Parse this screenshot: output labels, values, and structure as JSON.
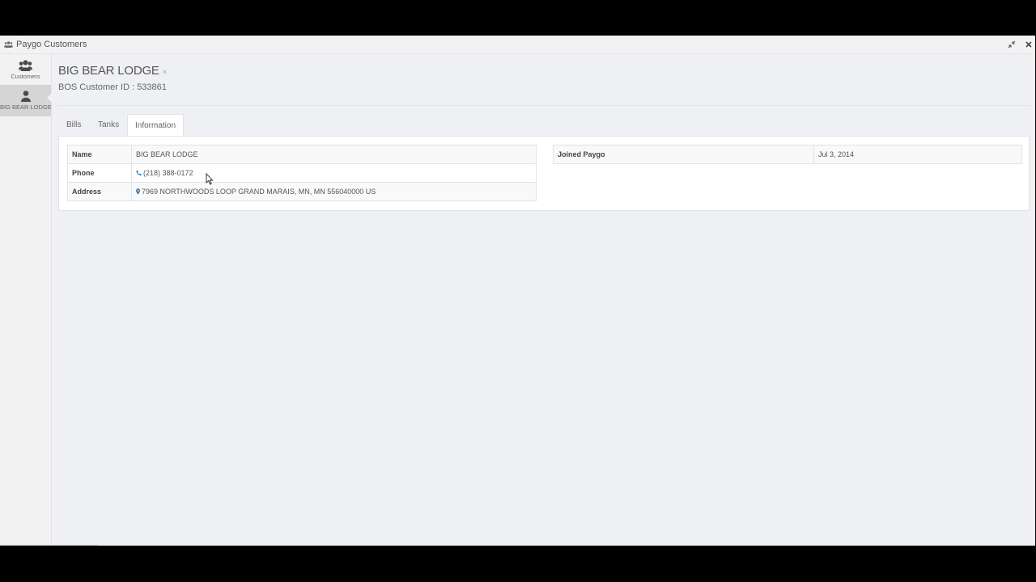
{
  "window": {
    "title": "Paygo Customers"
  },
  "sidebar": {
    "items": [
      {
        "label": "Customers",
        "icon": "users-icon"
      },
      {
        "label": "BIG BEAR LODGE",
        "icon": "user-icon",
        "active": true
      }
    ]
  },
  "header": {
    "title": "BIG BEAR LODGE",
    "close_glyph": "×",
    "subtitle": "BOS Customer ID : 533861"
  },
  "tabs": [
    {
      "label": "Bills"
    },
    {
      "label": "Tanks"
    },
    {
      "label": "Information",
      "active": true
    }
  ],
  "info": {
    "left": [
      {
        "key": "Name",
        "value": "BIG BEAR LODGE"
      },
      {
        "key": "Phone",
        "value": "(218) 388-0172",
        "icon": "phone-icon"
      },
      {
        "key": "Address",
        "value": "7969 NORTHWOODS LOOP GRAND MARAIS, MN, MN 556040000 US",
        "icon": "map-marker-icon"
      }
    ],
    "right": [
      {
        "key": "Joined Paygo",
        "value": "Jul 3, 2014"
      }
    ]
  },
  "colors": {
    "background": "#eff0f4",
    "icon_blue": "#3a7bbf",
    "text": "#555555"
  }
}
